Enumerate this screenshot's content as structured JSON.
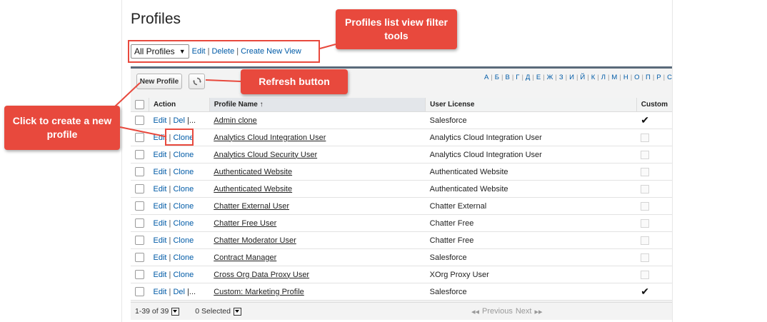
{
  "page_title": "Profiles",
  "filter": {
    "selected_view": "All Profiles",
    "edit": "Edit",
    "delete": "Delete",
    "create_new_view": "Create New View"
  },
  "toolbar": {
    "new_profile": "New Profile",
    "refresh_icon": "refresh-icon"
  },
  "alphabet": [
    "А",
    "Б",
    "В",
    "Г",
    "Д",
    "Е",
    "Ж",
    "З",
    "И",
    "Й",
    "К",
    "Л",
    "М",
    "Н",
    "О",
    "П",
    "Р",
    "С"
  ],
  "table": {
    "headers": {
      "action": "Action",
      "name": "Profile Name",
      "license": "User License",
      "custom": "Custom"
    },
    "sort_indicator": "↑",
    "rows": [
      {
        "a1": "Edit",
        "a2": "Del",
        "more": "|...",
        "name": "Admin clone",
        "license": "Salesforce",
        "custom": true
      },
      {
        "a1": "Edit",
        "a2": "Clone",
        "more": "",
        "name": "Analytics Cloud Integration User",
        "license": "Analytics Cloud Integration User",
        "custom": false
      },
      {
        "a1": "Edit",
        "a2": "Clone",
        "more": "",
        "name": "Analytics Cloud Security User",
        "license": "Analytics Cloud Integration User",
        "custom": false
      },
      {
        "a1": "Edit",
        "a2": "Clone",
        "more": "",
        "name": "Authenticated Website",
        "license": "Authenticated Website",
        "custom": false
      },
      {
        "a1": "Edit",
        "a2": "Clone",
        "more": "",
        "name": "Authenticated Website",
        "license": "Authenticated Website",
        "custom": false
      },
      {
        "a1": "Edit",
        "a2": "Clone",
        "more": "",
        "name": "Chatter External User",
        "license": "Chatter External",
        "custom": false
      },
      {
        "a1": "Edit",
        "a2": "Clone",
        "more": "",
        "name": "Chatter Free User",
        "license": "Chatter Free",
        "custom": false
      },
      {
        "a1": "Edit",
        "a2": "Clone",
        "more": "",
        "name": "Chatter Moderator User",
        "license": "Chatter Free",
        "custom": false
      },
      {
        "a1": "Edit",
        "a2": "Clone",
        "more": "",
        "name": "Contract Manager",
        "license": "Salesforce",
        "custom": false
      },
      {
        "a1": "Edit",
        "a2": "Clone",
        "more": "",
        "name": "Cross Org Data Proxy User",
        "license": "XOrg Proxy User",
        "custom": false
      },
      {
        "a1": "Edit",
        "a2": "Del",
        "more": "|...",
        "name": "Custom: Marketing Profile",
        "license": "Salesforce",
        "custom": true
      }
    ]
  },
  "footer": {
    "range": "1-39 of 39",
    "selected": "0 Selected",
    "previous": "Previous",
    "next": "Next"
  },
  "annotations": {
    "filter_tools": "Profiles list view filter tools",
    "refresh": "Refresh button",
    "clone": "Click to create a new profile"
  },
  "colors": {
    "callout": "#e8493d",
    "link": "#015ba7",
    "header_bar": "#5a6a7a"
  }
}
